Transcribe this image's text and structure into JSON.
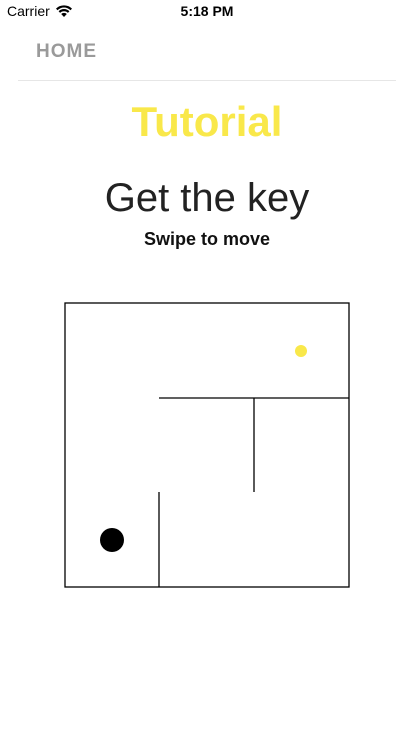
{
  "status_bar": {
    "carrier": "Carrier",
    "time": "5:18 PM",
    "wifi_icon": "wifi-icon"
  },
  "nav": {
    "home_label": "HOME"
  },
  "content": {
    "title": "Tutorial",
    "heading": "Get the key",
    "subheading": "Swipe to move"
  },
  "colors": {
    "accent": "#f9e84a",
    "home": "#9a9a9a",
    "player": "#000000"
  },
  "maze": {
    "player_icon": "player-ball",
    "key_icon": "key-dot"
  }
}
